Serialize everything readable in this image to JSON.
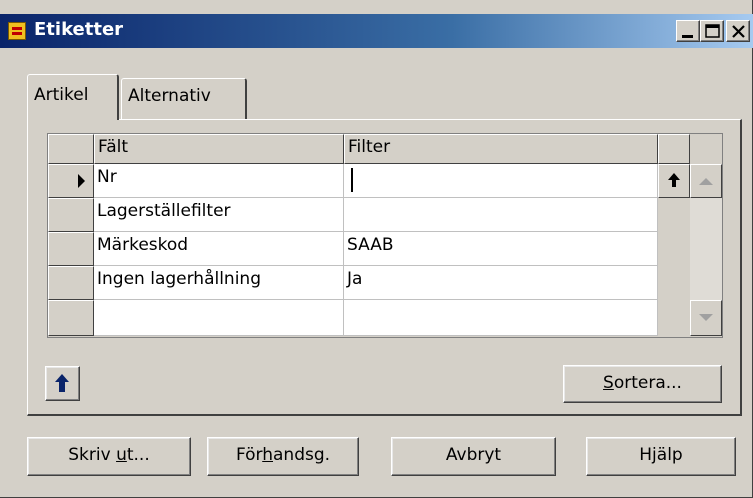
{
  "window": {
    "title": "Etiketter"
  },
  "tabs": [
    {
      "label": "Artikel",
      "active": true
    },
    {
      "label": "Alternativ",
      "active": false
    }
  ],
  "grid": {
    "columns": [
      "Fält",
      "Filter"
    ],
    "rows": [
      {
        "field": "Nr",
        "filter": "",
        "current": true
      },
      {
        "field": "Lagerställefilter",
        "filter": ""
      },
      {
        "field": "Märkeskod",
        "filter": "SAAB"
      },
      {
        "field": "Ingen lagerhållning",
        "filter": "Ja"
      },
      {
        "field": "",
        "filter": ""
      }
    ]
  },
  "buttons": {
    "sort": {
      "pre": "",
      "ul": "S",
      "post": "ortera..."
    },
    "print": {
      "pre": "Skriv ",
      "ul": "u",
      "post": "t..."
    },
    "preview": {
      "pre": "För",
      "ul": "h",
      "post": "andsg."
    },
    "cancel": {
      "pre": "Avbryt",
      "ul": "",
      "post": ""
    },
    "help": {
      "pre": "Hjälp",
      "ul": "",
      "post": ""
    }
  },
  "icons": {
    "app": "etiketter-app-icon",
    "minimize": "minimize-icon",
    "maximize": "maximize-icon",
    "close": "close-icon",
    "current_row": "row-pointer-icon",
    "up": "arrow-up-icon"
  }
}
